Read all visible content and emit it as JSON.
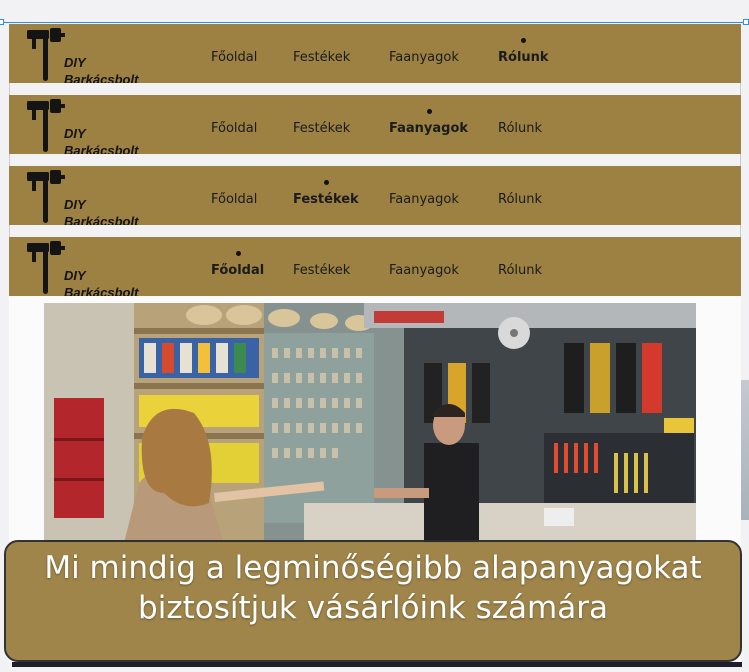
{
  "brand": {
    "line1": "DIY",
    "line2": "Barkácsbolt",
    "logo_icon": "paint-roller-hammer-icon"
  },
  "nav": {
    "items": [
      "Főoldal",
      "Festékek",
      "Faanyagok",
      "Rólunk"
    ]
  },
  "variants": [
    {
      "active": "Rólunk"
    },
    {
      "active": "Faanyagok"
    },
    {
      "active": "Festékek"
    },
    {
      "active": "Főoldal"
    }
  ],
  "hero": {
    "headline_line1": "Mi mindig a legminőségibb alapanyagokat",
    "headline_line2": "biztosítjuk vásárlóink számára"
  },
  "colors": {
    "brand": "#9c8143",
    "text": "#1b1b1b",
    "banner_text": "#ffffff"
  }
}
